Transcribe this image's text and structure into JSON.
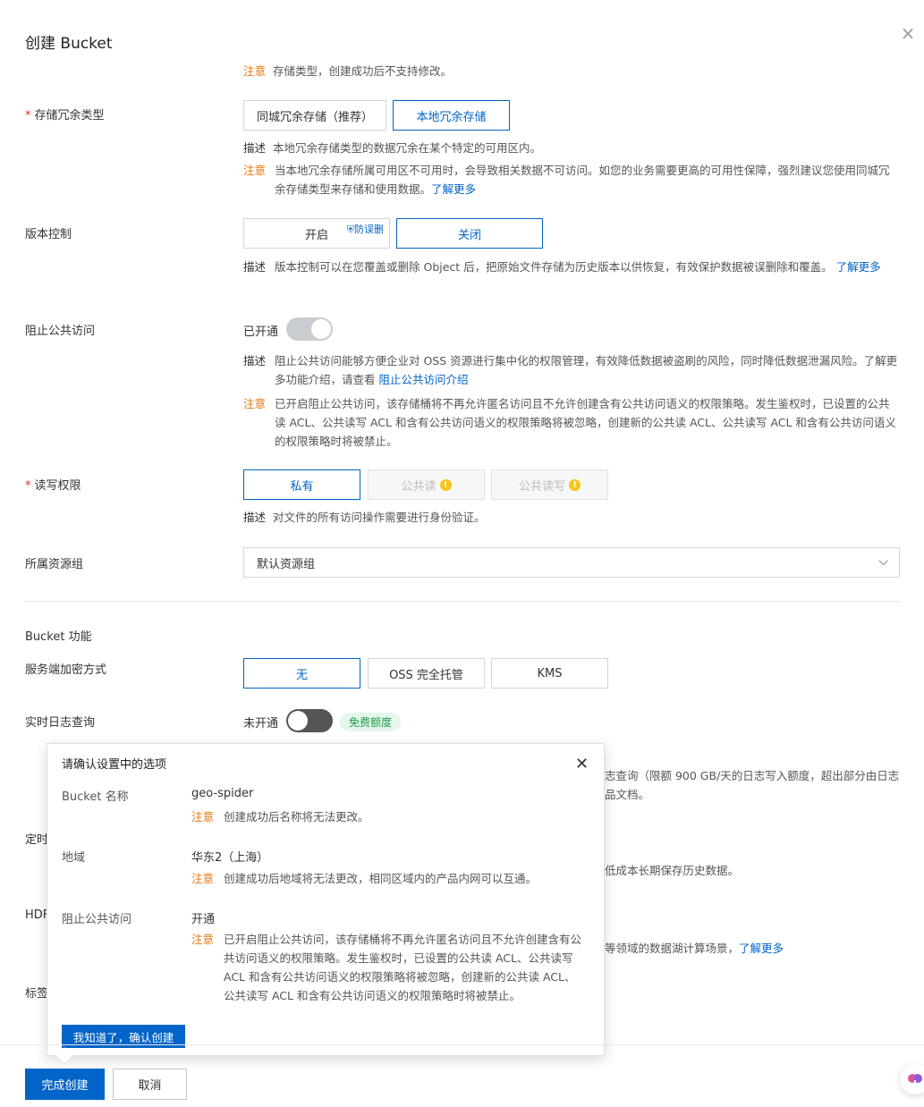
{
  "header": {
    "title": "创建 Bucket",
    "close_glyph": "×"
  },
  "top_note": {
    "tag": "注意",
    "text": "存储类型，创建成功后不支持修改。"
  },
  "redundancy": {
    "label": "存储冗余类型",
    "options": [
      "同城冗余存储（推荐）",
      "本地冗余存储"
    ],
    "selected": "本地冗余存储",
    "desc_tag": "描述",
    "desc": "本地冗余存储类型的数据冗余在某个特定的可用区内。",
    "note_tag": "注意",
    "note": "当本地冗余存储所属可用区不可用时，会导致相关数据不可访问。如您的业务需要更高的可用性保障，强烈建议您使用同城冗余存储类型来存储和使用数据。",
    "learn_more": "了解更多"
  },
  "versioning": {
    "label": "版本控制",
    "options": [
      "开启",
      "关闭"
    ],
    "badge": "防误删",
    "selected": "关闭",
    "desc_tag": "描述",
    "desc": "版本控制可以在您覆盖或删除 Object 后，把原始文件存储为历史版本以供恢复，有效保护数据被误删除和覆盖。",
    "learn_more": "了解更多"
  },
  "block_public": {
    "label": "阻止公共访问",
    "status": "已开通",
    "desc_tag": "描述",
    "desc": "阻止公共访问能够方便企业对 OSS 资源进行集中化的权限管理，有效降低数据被盗刷的风险，同时降低数据泄漏风险。了解更多功能介绍，请查看",
    "desc_link": "阻止公共访问介绍",
    "note_tag": "注意",
    "note": "已开启阻止公共访问，该存储桶将不再允许匿名访问且不允许创建含有公共访问语义的权限策略。发生鉴权时，已设置的公共读 ACL、公共读写 ACL 和含有公共访问语义的权限策略将被忽略，创建新的公共读 ACL、公共读写 ACL 和含有公共访问语义的权限策略时将被禁止。"
  },
  "acl": {
    "label": "读写权限",
    "options": [
      "私有",
      "公共读",
      "公共读写"
    ],
    "selected": "私有",
    "desc_tag": "描述",
    "desc": "对文件的所有访问操作需要进行身份验证。"
  },
  "resource_group": {
    "label": "所属资源组",
    "value": "默认资源组"
  },
  "features": {
    "section_title": "Bucket 功能",
    "encryption": {
      "label": "服务端加密方式",
      "options": [
        "无",
        "OSS 完全托管",
        "KMS"
      ],
      "selected": "无"
    },
    "realtime_log": {
      "label": "实时日志查询",
      "status": "未开通",
      "badge": "免费额度",
      "partial_text": "志查询（限额 900 GB/天的日志写入额度，超出部分由日志",
      "partial_link": "品文档。"
    },
    "scheduled_backup": {
      "label_partial": "定时",
      "partial_text": "低成本长期保存历史数据。"
    },
    "hdfs": {
      "label_partial": "HDF",
      "partial_text": "等领域的数据湖计算场景，",
      "partial_link": "了解更多"
    },
    "tags": {
      "label_partial": "标签"
    }
  },
  "confirm_popover": {
    "title": "请确认设置中的选项",
    "close_glyph": "✕",
    "items": [
      {
        "label": "Bucket 名称",
        "value": "geo-spider",
        "note_tag": "注意",
        "note": "创建成功后名称将无法更改。"
      },
      {
        "label": "地域",
        "value": "华东2（上海）",
        "note_tag": "注意",
        "note": "创建成功后地域将无法更改，相同区域内的产品内网可以互通。"
      },
      {
        "label": "阻止公共访问",
        "value": "开通",
        "note_tag": "注意",
        "note": "已开启阻止公共访问，该存储桶将不再允许匿名访问且不允许创建含有公共访问语义的权限策略。发生鉴权时，已设置的公共读 ACL、公共读写 ACL 和含有公共访问语义的权限策略将被忽略，创建新的公共读 ACL、公共读写 ACL 和含有公共访问语义的权限策略时将被禁止。"
      }
    ],
    "confirm_button": "我知道了，确认创建"
  },
  "footer": {
    "submit": "完成创建",
    "cancel": "取消"
  },
  "colors": {
    "primary": "#0064c8",
    "warning": "#e8750c",
    "success_bg": "#e5f7ec",
    "success": "#1e9c4a"
  },
  "icons": [
    "close-icon",
    "chevron-down-icon",
    "shield-icon",
    "warning-icon",
    "assistant-icon"
  ]
}
